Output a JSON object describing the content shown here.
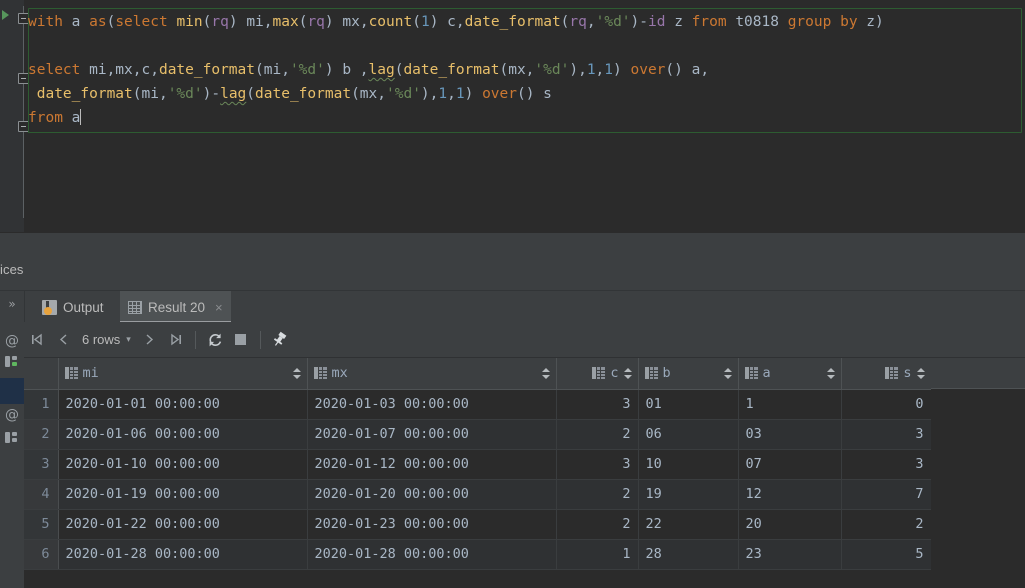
{
  "editor": {
    "code_lines": [
      {
        "tokens": [
          {
            "t": "with",
            "c": "kw"
          },
          {
            "t": " a ",
            "c": "id"
          },
          {
            "t": "as",
            "c": "kw"
          },
          {
            "t": "(",
            "c": "punc"
          },
          {
            "t": "select",
            "c": "kw"
          },
          {
            "t": " ",
            "c": "id"
          },
          {
            "t": "min",
            "c": "fn"
          },
          {
            "t": "(",
            "c": "punc"
          },
          {
            "t": "rq",
            "c": "vio"
          },
          {
            "t": ")",
            "c": "punc"
          },
          {
            "t": " mi,",
            "c": "id"
          },
          {
            "t": "max",
            "c": "fn"
          },
          {
            "t": "(",
            "c": "punc"
          },
          {
            "t": "rq",
            "c": "vio"
          },
          {
            "t": ")",
            "c": "punc"
          },
          {
            "t": " mx,",
            "c": "id"
          },
          {
            "t": "count",
            "c": "fn"
          },
          {
            "t": "(",
            "c": "punc"
          },
          {
            "t": "1",
            "c": "num"
          },
          {
            "t": ")",
            "c": "punc"
          },
          {
            "t": " c,",
            "c": "id"
          },
          {
            "t": "date_format",
            "c": "fn"
          },
          {
            "t": "(",
            "c": "punc"
          },
          {
            "t": "rq",
            "c": "vio"
          },
          {
            "t": ",",
            "c": "punc"
          },
          {
            "t": "'%d'",
            "c": "str"
          },
          {
            "t": ")",
            "c": "punc"
          },
          {
            "t": "-",
            "c": "punc"
          },
          {
            "t": "id",
            "c": "vio"
          },
          {
            "t": " z ",
            "c": "id"
          },
          {
            "t": "from",
            "c": "kw"
          },
          {
            "t": " t0818 ",
            "c": "id"
          },
          {
            "t": "group",
            "c": "kw"
          },
          {
            "t": " ",
            "c": "id"
          },
          {
            "t": "by",
            "c": "kw"
          },
          {
            "t": " z",
            "c": "id"
          },
          {
            "t": ")",
            "c": "punc"
          }
        ]
      },
      {
        "tokens": []
      },
      {
        "tokens": [
          {
            "t": "select",
            "c": "kw"
          },
          {
            "t": " mi,mx,c,",
            "c": "id"
          },
          {
            "t": "date_format",
            "c": "fn"
          },
          {
            "t": "(",
            "c": "punc"
          },
          {
            "t": "mi,",
            "c": "id"
          },
          {
            "t": "'%d'",
            "c": "str"
          },
          {
            "t": ")",
            "c": "punc"
          },
          {
            "t": " b ,",
            "c": "id"
          },
          {
            "t": "lag",
            "c": "fn typo"
          },
          {
            "t": "(",
            "c": "punc"
          },
          {
            "t": "date_format",
            "c": "fn"
          },
          {
            "t": "(",
            "c": "punc"
          },
          {
            "t": "mx,",
            "c": "id"
          },
          {
            "t": "'%d'",
            "c": "str"
          },
          {
            "t": ")",
            "c": "punc"
          },
          {
            "t": ",",
            "c": "punc"
          },
          {
            "t": "1",
            "c": "num"
          },
          {
            "t": ",",
            "c": "punc"
          },
          {
            "t": "1",
            "c": "num"
          },
          {
            "t": ")",
            "c": "punc"
          },
          {
            "t": " ",
            "c": "id"
          },
          {
            "t": "over",
            "c": "kw"
          },
          {
            "t": "()",
            "c": "punc"
          },
          {
            "t": " a,",
            "c": "id"
          }
        ]
      },
      {
        "tokens": [
          {
            "t": " ",
            "c": "id"
          },
          {
            "t": "date_format",
            "c": "fn"
          },
          {
            "t": "(",
            "c": "punc"
          },
          {
            "t": "mi,",
            "c": "id"
          },
          {
            "t": "'%d'",
            "c": "str"
          },
          {
            "t": ")",
            "c": "punc"
          },
          {
            "t": "-",
            "c": "punc"
          },
          {
            "t": "lag",
            "c": "fn typo"
          },
          {
            "t": "(",
            "c": "punc"
          },
          {
            "t": "date_format",
            "c": "fn"
          },
          {
            "t": "(",
            "c": "punc"
          },
          {
            "t": "mx,",
            "c": "id"
          },
          {
            "t": "'%d'",
            "c": "str"
          },
          {
            "t": ")",
            "c": "punc"
          },
          {
            "t": ",",
            "c": "punc"
          },
          {
            "t": "1",
            "c": "num"
          },
          {
            "t": ",",
            "c": "punc"
          },
          {
            "t": "1",
            "c": "num"
          },
          {
            "t": ")",
            "c": "punc"
          },
          {
            "t": " ",
            "c": "id"
          },
          {
            "t": "over",
            "c": "kw"
          },
          {
            "t": "()",
            "c": "punc"
          },
          {
            "t": " s",
            "c": "id"
          }
        ]
      },
      {
        "tokens": [
          {
            "t": "from",
            "c": "kw"
          },
          {
            "t": " a",
            "c": "id"
          }
        ],
        "caret": true
      }
    ],
    "colors": {
      "background": "#2b2b2b",
      "keyword": "#cc7832",
      "function": "#e8bf6a",
      "string": "#6a8759",
      "number": "#6897bb",
      "variable": "#9876aa",
      "identifier": "#a9b7c6",
      "statement_border": "#2d5c31"
    }
  },
  "services": {
    "label": "ices"
  },
  "tabs": {
    "expand_label": "»",
    "items": [
      {
        "label": "Output",
        "icon": "output-icon",
        "active": false
      },
      {
        "label": "Result 20",
        "icon": "grid-icon",
        "active": true,
        "close_label": "×"
      }
    ]
  },
  "toolbar": {
    "first_page_label": "|◀",
    "prev_page_label": "‹",
    "rows_label": "6 rows",
    "rows_chevron": "▾",
    "next_page_label": "›",
    "last_page_label": "▶|",
    "refresh_label": "refresh-icon",
    "stop_label": "stop-icon",
    "pin_label": "pin-icon"
  },
  "left_strip": {
    "items": [
      {
        "icon": "at-icon",
        "label": "@"
      },
      {
        "icon": "database-icon",
        "label": ""
      },
      {
        "icon": "at-icon",
        "label": "@"
      },
      {
        "icon": "database-icon",
        "label": ""
      }
    ]
  },
  "result_grid": {
    "columns": [
      {
        "name": "mi",
        "align": "left"
      },
      {
        "name": "mx",
        "align": "left"
      },
      {
        "name": "c",
        "align": "right"
      },
      {
        "name": "b",
        "align": "left"
      },
      {
        "name": "a",
        "align": "left"
      },
      {
        "name": "s",
        "align": "right"
      }
    ],
    "rows": [
      {
        "n": "1",
        "mi": "2020-01-01 00:00:00",
        "mx": "2020-01-03 00:00:00",
        "c": "3",
        "b": "01",
        "a": "1",
        "s": "0"
      },
      {
        "n": "2",
        "mi": "2020-01-06 00:00:00",
        "mx": "2020-01-07 00:00:00",
        "c": "2",
        "b": "06",
        "a": "03",
        "s": "3"
      },
      {
        "n": "3",
        "mi": "2020-01-10 00:00:00",
        "mx": "2020-01-12 00:00:00",
        "c": "3",
        "b": "10",
        "a": "07",
        "s": "3"
      },
      {
        "n": "4",
        "mi": "2020-01-19 00:00:00",
        "mx": "2020-01-20 00:00:00",
        "c": "2",
        "b": "19",
        "a": "12",
        "s": "7"
      },
      {
        "n": "5",
        "mi": "2020-01-22 00:00:00",
        "mx": "2020-01-23 00:00:00",
        "c": "2",
        "b": "22",
        "a": "20",
        "s": "2"
      },
      {
        "n": "6",
        "mi": "2020-01-28 00:00:00",
        "mx": "2020-01-28 00:00:00",
        "c": "1",
        "b": "28",
        "a": "23",
        "s": "5"
      }
    ]
  }
}
